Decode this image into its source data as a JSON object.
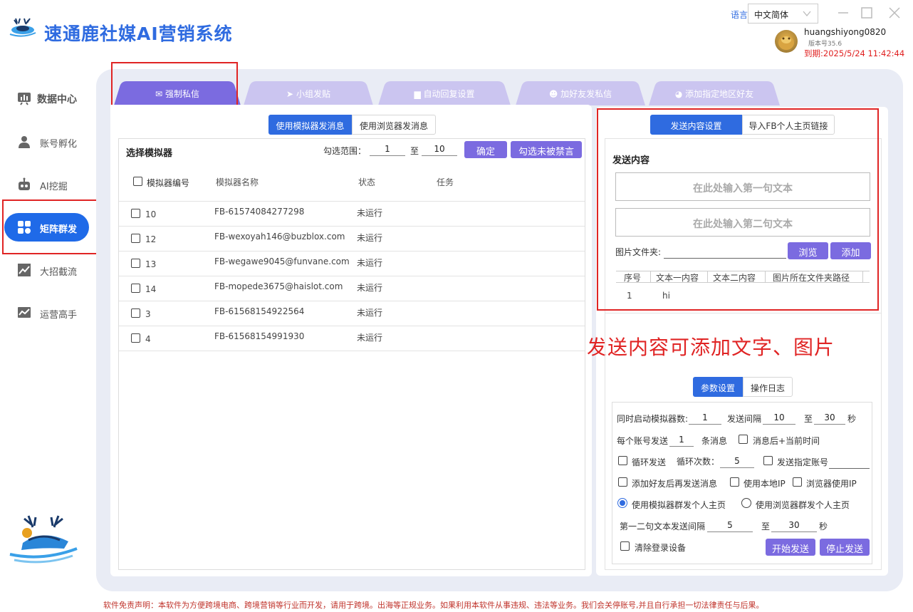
{
  "header": {
    "title": "速通鹿社媒AI营销系统",
    "language_label": "语言",
    "language_value": "中文简体",
    "user_name": "huangshiyong0820",
    "version": "版本号35.6",
    "expire": "到期:2025/5/24 11:42:44"
  },
  "sidebar": {
    "items": [
      {
        "label": "数据中心",
        "icon": "chart-board-icon"
      },
      {
        "label": "账号孵化",
        "icon": "user-icon"
      },
      {
        "label": "AI挖掘",
        "icon": "robot-icon"
      },
      {
        "label": "矩阵群发",
        "icon": "grid-apps-icon"
      },
      {
        "label": "大招截流",
        "icon": "trend-up-icon"
      },
      {
        "label": "运营高手",
        "icon": "line-chart-icon"
      }
    ]
  },
  "tabs": [
    {
      "label": "强制私信",
      "icon": "mail-icon"
    },
    {
      "label": "小组发贴",
      "icon": "send-icon"
    },
    {
      "label": "自动回复设置",
      "icon": "chat-icon"
    },
    {
      "label": "加好友发私信",
      "icon": "add-user-icon"
    },
    {
      "label": "添加指定地区好友",
      "icon": "globe-icon"
    }
  ],
  "send_mode": {
    "simulator": "使用模拟器发消息",
    "browser": "使用浏览器发消息"
  },
  "simulator": {
    "title": "选择模拟器",
    "range_label": "勾选范围：",
    "range_from": "1",
    "range_to_label": "至",
    "range_to": "10",
    "confirm": "确定",
    "select_unbanned": "勾选未被禁言",
    "columns": [
      "模拟器编号",
      "模拟器名称",
      "状态",
      "任务"
    ],
    "rows": [
      {
        "id": "10",
        "name": "FB-61574084277298",
        "status": "未运行",
        "task": ""
      },
      {
        "id": "12",
        "name": "FB-wexoyah146@buzblox.com",
        "status": "未运行",
        "task": ""
      },
      {
        "id": "13",
        "name": "FB-wegawe9045@funvane.com",
        "status": "未运行",
        "task": ""
      },
      {
        "id": "14",
        "name": "FB-mopede3675@haislot.com",
        "status": "未运行",
        "task": ""
      },
      {
        "id": "3",
        "name": "FB-61568154922564",
        "status": "未运行",
        "task": ""
      },
      {
        "id": "4",
        "name": "FB-61568154991930",
        "status": "未运行",
        "task": ""
      }
    ]
  },
  "content": {
    "tab_settings": "发送内容设置",
    "tab_import": "导入FB个人主页链接",
    "title": "发送内容",
    "placeholder1": "在此处输入第一句文本",
    "placeholder2": "在此处输入第二句文本",
    "folder_label": "图片文件夹:",
    "browse": "浏览",
    "add": "添加",
    "columns": [
      "序号",
      "文本一内容",
      "文本二内容",
      "图片所在文件夹路径"
    ],
    "rows": [
      {
        "no": "1",
        "text1": "hi",
        "text2": "",
        "path": ""
      }
    ]
  },
  "annotation": "发送内容可添加文字、图片",
  "params": {
    "tab_params": "参数设置",
    "tab_log": "操作日志",
    "concurrent_label": "同时启动模拟器数:",
    "concurrent": "1",
    "interval_label": "发送间隔",
    "interval_from": "10",
    "interval_to_label": "至",
    "interval_to": "30",
    "interval_unit": "秒",
    "per_account_label": "每个账号发送",
    "per_account": "1",
    "per_account_unit": "条消息",
    "append_time": "消息后+当前时间",
    "loop_send": "循环发送",
    "loop_count_label": "循环次数：",
    "loop_count": "5",
    "send_specified": "发送指定账号",
    "add_friend_then_send": "添加好友后再发送消息",
    "use_local_ip": "使用本地IP",
    "browser_ip": "浏览器使用IP",
    "radio_simulator": "使用模拟器群发个人主页",
    "radio_browser": "使用浏览器群发个人主页",
    "second_interval_label": "第一二句文本发送间隔",
    "second_from": "5",
    "second_to_label": "至",
    "second_to": "30",
    "second_unit": "秒",
    "clear_device": "清除登录设备",
    "start": "开始发送",
    "stop": "停止发送"
  },
  "disclaimer": "软件免责声明：本软件为方便跨境电商、跨境营销等行业而开发，请用于跨境。出海等正规业务。如果利用本软件从事违规、违法等业务。我们会关停账号,并且自行承担一切法律责任与后果。",
  "colors": {
    "primary": "#2f6be0",
    "purple": "#7b6be0",
    "tab_active": "#7b6be0",
    "tab_inactive": "#cbc5f0",
    "annotation_red": "#e02424"
  }
}
